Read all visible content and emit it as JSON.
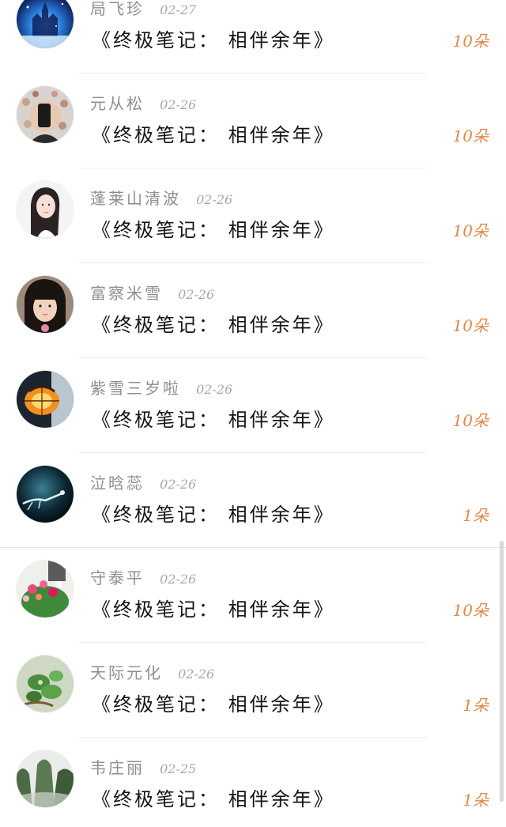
{
  "gift_records": [
    {
      "user": "局飞珍",
      "date": "02-27",
      "title": "《终极笔记：  相伴余年》",
      "count": "10朵",
      "avatar_icon": "night-castle-avatar-icon"
    },
    {
      "user": "元从松",
      "date": "02-26",
      "title": "《终极笔记：  相伴余年》",
      "count": "10朵",
      "avatar_icon": "phone-selfie-avatar-icon"
    },
    {
      "user": "蓬莱山清波",
      "date": "02-26",
      "title": "《终极笔记：  相伴余年》",
      "count": "10朵",
      "avatar_icon": "girl-portrait-avatar-icon"
    },
    {
      "user": "富察米雪",
      "date": "02-26",
      "title": "《终极笔记：  相伴余年》",
      "count": "10朵",
      "avatar_icon": "child-portrait-avatar-icon"
    },
    {
      "user": "紫雪三岁啦",
      "date": "02-26",
      "title": "《终极笔记：  相伴余年》",
      "count": "10朵",
      "avatar_icon": "lantern-avatar-icon"
    },
    {
      "user": "泣晗蕊",
      "date": "02-26",
      "title": "《终极笔记：  相伴余年》",
      "count": "1朵",
      "avatar_icon": "underwater-avatar-icon"
    },
    {
      "user": "守泰平",
      "date": "02-26",
      "title": "《终极笔记：  相伴余年》",
      "count": "10朵",
      "avatar_icon": "flowers-avatar-icon"
    },
    {
      "user": "天际元化",
      "date": "02-26",
      "title": "《终极笔记：  相伴余年》",
      "count": "1朵",
      "avatar_icon": "plant-avatar-icon"
    },
    {
      "user": "韦庄丽",
      "date": "02-25",
      "title": "《终极笔记：  相伴余年》",
      "count": "1朵",
      "avatar_icon": "mountain-avatar-icon"
    }
  ],
  "colors": {
    "count": "#e0884a",
    "name": "#8e8e8e",
    "title": "#151515"
  }
}
